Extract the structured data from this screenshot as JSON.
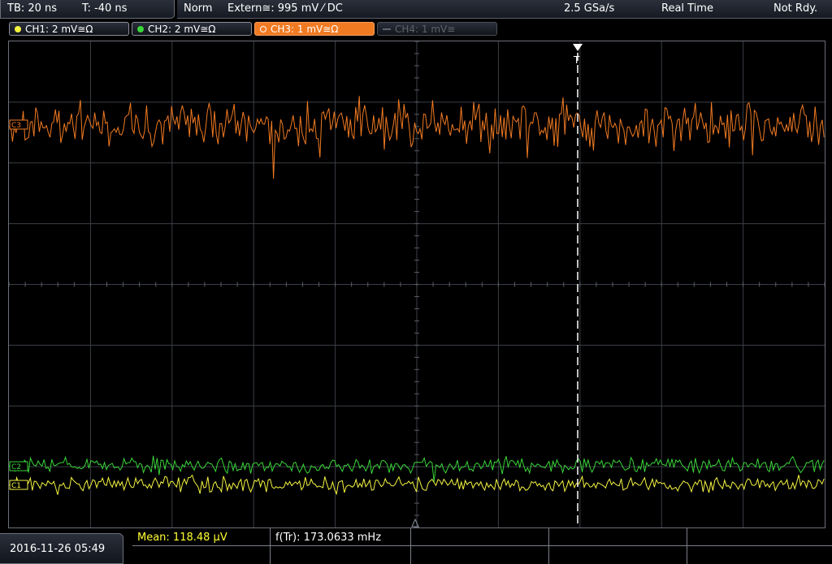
{
  "header": {
    "timebase": "TB: 20 ns",
    "trigger_time": "T: -40 ns",
    "mode": "Norm",
    "trigger_source": "Extern≅: 995 mV ⁄ DC",
    "sample_rate": "2.5 GSa/s",
    "acq_mode": "Real Time",
    "status": "Not Rdy."
  },
  "channels": [
    {
      "label": "CH1: 2 mV≅Ω",
      "color": "#f5f542",
      "state": "on"
    },
    {
      "label": "CH2: 2 mV≅Ω",
      "color": "#39d639",
      "state": "on"
    },
    {
      "label": "CH3: 1 mV≅Ω",
      "color": "#f07a22",
      "state": "selected"
    },
    {
      "label": "CH4: 1 mV≅",
      "color": "#5e626b",
      "state": "off"
    }
  ],
  "markers": {
    "ch3": "C3",
    "ch2": "C2",
    "ch1": "C1",
    "trigger": "T"
  },
  "footer": {
    "datetime": "2016-11-26 05:49",
    "mean": "Mean: 118.48 µV",
    "freq": "f(Tr): 173.0633 mHz"
  },
  "colors": {
    "ch1": "#f5f542",
    "ch2": "#39d639",
    "ch3": "#f07a22",
    "grid": "#3b3f46"
  }
}
